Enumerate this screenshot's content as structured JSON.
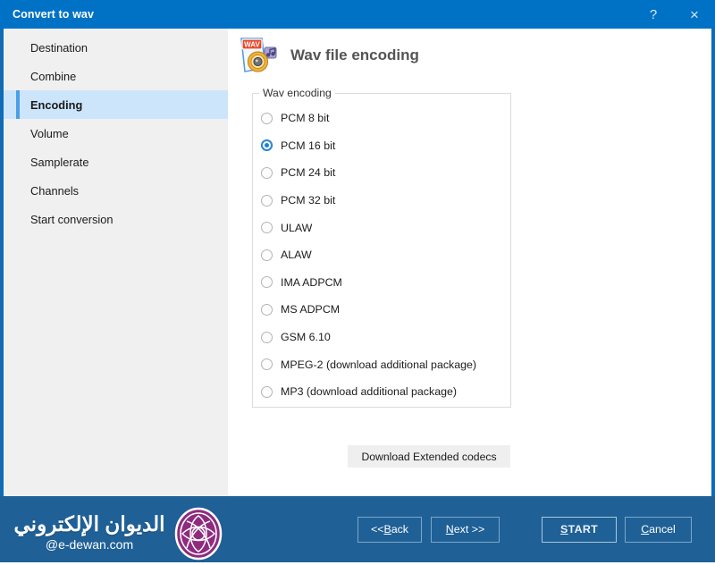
{
  "window": {
    "title": "Convert to wav",
    "help_icon": "?",
    "close_icon": "×"
  },
  "sidebar": {
    "items": [
      {
        "label": "Destination",
        "selected": false
      },
      {
        "label": "Combine",
        "selected": false
      },
      {
        "label": "Encoding",
        "selected": true
      },
      {
        "label": "Volume",
        "selected": false
      },
      {
        "label": "Samplerate",
        "selected": false
      },
      {
        "label": "Channels",
        "selected": false
      },
      {
        "label": "Start conversion",
        "selected": false
      }
    ]
  },
  "page": {
    "title": "Wav file encoding",
    "icon": "wav-file-audio-icon",
    "icon_badge_text": "WAV"
  },
  "encoding_group": {
    "legend": "Wav encoding",
    "options": [
      {
        "label": "PCM 8 bit",
        "checked": false
      },
      {
        "label": "PCM 16 bit",
        "checked": true
      },
      {
        "label": "PCM 24 bit",
        "checked": false
      },
      {
        "label": "PCM 32 bit",
        "checked": false
      },
      {
        "label": "ULAW",
        "checked": false
      },
      {
        "label": "ALAW",
        "checked": false
      },
      {
        "label": "IMA ADPCM",
        "checked": false
      },
      {
        "label": "MS ADPCM",
        "checked": false
      },
      {
        "label": "GSM 6.10",
        "checked": false
      },
      {
        "label": "MPEG-2 (download additional package)",
        "checked": false
      },
      {
        "label": "MP3 (download additional package)",
        "checked": false
      }
    ]
  },
  "actions": {
    "download_codecs": "Download Extended codecs"
  },
  "navigation": {
    "back": {
      "pre": "<< ",
      "accel": "B",
      "post": "ack"
    },
    "next": {
      "pre": "",
      "accel": "N",
      "post": "ext >>"
    },
    "start": {
      "pre": "",
      "accel": "S",
      "post": "TART"
    },
    "cancel": {
      "pre": "",
      "accel": "C",
      "post": "ancel"
    }
  },
  "watermark": {
    "arabic": "الديوان الإلكتروني",
    "site": "@e-dewan.com",
    "logo": "e-dewan-circular-logo"
  },
  "colors": {
    "titlebar": "#0072c6",
    "bottombar": "#1f6096",
    "sidebar": "#f0f0f0",
    "selection": "#cde5fb",
    "selection_accent": "#4a9fe8",
    "radio_accent": "#1e7fd0",
    "watermark_logo": "#8e2b7f"
  }
}
